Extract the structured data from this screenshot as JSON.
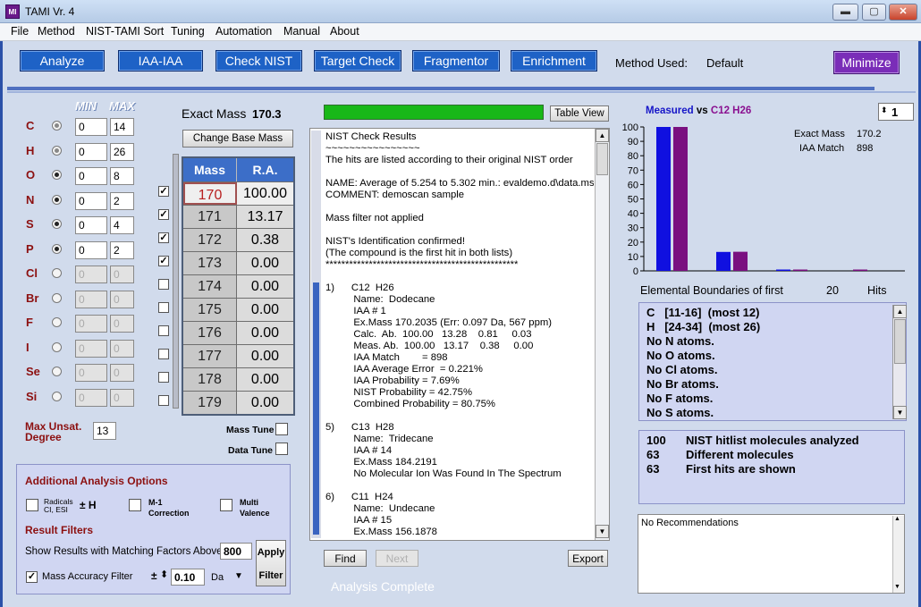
{
  "window": {
    "title": "TAMI Vr. 4",
    "icon_text": "MI",
    "minimize_glyph": "▬",
    "maximize_glyph": "▢",
    "close_glyph": "✕"
  },
  "menu": [
    "File",
    "Method",
    "NIST-TAMI Sort",
    "Tuning",
    "Automation",
    "Manual",
    "About"
  ],
  "toolbar": {
    "buttons": [
      "Analyze",
      "IAA-IAA",
      "Check NIST",
      "Target Check",
      "Fragmentor",
      "Enrichment"
    ],
    "method_label": "Method Used:",
    "method_value": "Default",
    "minimize_label": "Minimize"
  },
  "elements": {
    "min_header": "MIN",
    "max_header": "MAX",
    "rows": [
      {
        "symbol": "C",
        "min": "0",
        "max": "14",
        "enabled": true,
        "selected": false
      },
      {
        "symbol": "H",
        "min": "0",
        "max": "26",
        "enabled": true,
        "selected": false
      },
      {
        "symbol": "O",
        "min": "0",
        "max": "8",
        "enabled": true,
        "selected": true
      },
      {
        "symbol": "N",
        "min": "0",
        "max": "2",
        "enabled": true,
        "selected": true
      },
      {
        "symbol": "S",
        "min": "0",
        "max": "4",
        "enabled": true,
        "selected": true
      },
      {
        "symbol": "P",
        "min": "0",
        "max": "2",
        "enabled": true,
        "selected": true
      },
      {
        "symbol": "Cl",
        "min": "0",
        "max": "0",
        "enabled": false,
        "selected": false
      },
      {
        "symbol": "Br",
        "min": "0",
        "max": "0",
        "enabled": false,
        "selected": false
      },
      {
        "symbol": "F",
        "min": "0",
        "max": "0",
        "enabled": false,
        "selected": false
      },
      {
        "symbol": "I",
        "min": "0",
        "max": "0",
        "enabled": false,
        "selected": false
      },
      {
        "symbol": "Se",
        "min": "0",
        "max": "0",
        "enabled": false,
        "selected": false
      },
      {
        "symbol": "Si",
        "min": "0",
        "max": "0",
        "enabled": false,
        "selected": false
      }
    ],
    "max_unsat_label": "Max Unsat.\nDegree",
    "max_unsat_value": "13"
  },
  "exact_mass": {
    "label": "Exact Mass",
    "value": "170.3",
    "change_button": "Change Base Mass"
  },
  "mass_table": {
    "headers": [
      "Mass",
      "R.A."
    ],
    "rows": [
      {
        "mass": "170",
        "ra": "100.00",
        "checked": true,
        "selected": true
      },
      {
        "mass": "171",
        "ra": "13.17",
        "checked": true,
        "selected": false
      },
      {
        "mass": "172",
        "ra": "0.38",
        "checked": true,
        "selected": false
      },
      {
        "mass": "173",
        "ra": "0.00",
        "checked": true,
        "selected": false
      },
      {
        "mass": "174",
        "ra": "0.00",
        "checked": false,
        "selected": false
      },
      {
        "mass": "175",
        "ra": "0.00",
        "checked": false,
        "selected": false
      },
      {
        "mass": "176",
        "ra": "0.00",
        "checked": false,
        "selected": false
      },
      {
        "mass": "177",
        "ra": "0.00",
        "checked": false,
        "selected": false
      },
      {
        "mass": "178",
        "ra": "0.00",
        "checked": false,
        "selected": false
      },
      {
        "mass": "179",
        "ra": "0.00",
        "checked": false,
        "selected": false
      }
    ]
  },
  "tune": {
    "mass_tune": "Mass Tune",
    "data_tune": "Data Tune"
  },
  "analysis_options": {
    "title": "Additional Analysis Options",
    "radicals": "Radicals\nCI, ESI",
    "radicals_sym": "± H",
    "m1": "M-1\nCorrection",
    "multi": "Multi\nValence"
  },
  "result_filters": {
    "title": "Result Filters",
    "show_label": "Show Results with Matching Factors Above",
    "show_value": "800",
    "apply_label": "Apply\nFilter",
    "mass_acc_label": "Mass Accuracy Filter",
    "mass_acc_checked": true,
    "plusminus": "±",
    "tolerance": "0.10",
    "unit": "Da",
    "spin_glyph": "⬍",
    "dropdown_glyph": "▼"
  },
  "results": {
    "table_view_label": "Table View",
    "progress_fraction": 1.0,
    "text": "NIST Check Results\n~~~~~~~~~~~~~~~~\nThe hits are listed according to their original NIST order\n\nNAME: Average of 5.254 to 5.302 min.: evaldemo.d\\data.ms\nCOMMENT: demoscan sample\n\nMass filter not applied\n\nNIST's Identification confirmed!\n(The compound is the first hit in both lists)\n*************************************************\n\n1)      C12  H26\n          Name:  Dodecane\n          IAA # 1\n          Ex.Mass 170.2035 (Err: 0.097 Da, 567 ppm)\n          Calc.  Ab.  100.00   13.28    0.81     0.03\n          Meas. Ab.  100.00   13.17    0.38     0.00\n          IAA Match        = 898\n          IAA Average Error  = 0.221%\n          IAA Probability = 7.69%\n          NIST Probability = 42.75%\n          Combined Probability = 80.75%\n\n5)      C13  H28\n          Name:  Tridecane\n          IAA # 14\n          Ex.Mass 184.2191\n          No Molecular Ion Was Found In The Spectrum\n\n6)      C11  H24\n          Name:  Undecane\n          IAA # 15\n          Ex.Mass 156.1878",
    "find_label": "Find",
    "next_label": "Next",
    "export_label": "Export",
    "status": "Analysis Complete"
  },
  "spectrum": {
    "title_measured": "Measured",
    "title_vs": "vs",
    "title_formula": "C12  H26",
    "spinner_value": "1",
    "exact_mass_label": "Exact Mass",
    "exact_mass_value": "170.2",
    "iaa_match_label": "IAA Match",
    "iaa_match_value": "898",
    "y_ticks": [
      "100",
      "90",
      "80",
      "70",
      "60",
      "50",
      "40",
      "30",
      "20",
      "10",
      "0"
    ]
  },
  "chart_data": {
    "type": "bar",
    "categories": [
      "170",
      "171",
      "172",
      "173"
    ],
    "series": [
      {
        "values": [
          100.0,
          13.17,
          0.38,
          0.0
        ],
        "color": "#1010e0"
      },
      {
        "values": [
          100.0,
          13.28,
          0.81,
          0.03
        ],
        "color": "#7a1080"
      }
    ],
    "ylim": [
      0,
      100
    ]
  },
  "boundaries": {
    "label": "Elemental Boundaries of first",
    "count": "20",
    "unit": "Hits",
    "lines": [
      "C   [11-16]  (most 12)",
      "H   [24-34]  (most 26)",
      "No N atoms.",
      "No O atoms.",
      "No Cl atoms.",
      "No Br atoms.",
      "No F atoms.",
      "No S atoms."
    ]
  },
  "summary": [
    {
      "num": "100",
      "text": "NIST hitlist molecules analyzed"
    },
    {
      "num": "63",
      "text": "Different molecules"
    },
    {
      "num": "63",
      "text": "First hits are shown"
    }
  ],
  "recommendations": "No Recommendations"
}
